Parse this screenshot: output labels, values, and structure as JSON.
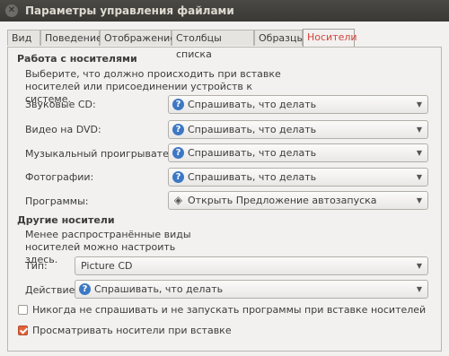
{
  "window": {
    "title": "Параметры управления файлами",
    "close_glyph": "✕"
  },
  "tabs": [
    {
      "label": "Вид"
    },
    {
      "label": "Поведение"
    },
    {
      "label": "Отображение"
    },
    {
      "label": "Столбцы списка"
    },
    {
      "label": "Образцы"
    },
    {
      "label": "Носители",
      "active": true
    }
  ],
  "media": {
    "heading": "Работа с носителями",
    "description": "Выберите, что должно происходить при вставке носителей или присоединении устройств к системе.",
    "rows": [
      {
        "label": "Звуковые CD:",
        "value": "Спрашивать, что делать",
        "icon": "question-icon"
      },
      {
        "label": "Видео на DVD:",
        "value": "Спрашивать, что делать",
        "icon": "question-icon"
      },
      {
        "label": "Музыкальный проигрыватель:",
        "value": "Спрашивать, что делать",
        "icon": "question-icon"
      },
      {
        "label": "Фотографии:",
        "value": "Спрашивать, что делать",
        "icon": "question-icon"
      },
      {
        "label": "Программы:",
        "value": "Открыть Предложение автозапуска",
        "icon": "autorun-icon"
      }
    ]
  },
  "other": {
    "heading": "Другие носители",
    "description": "Менее распространённые виды носителей можно настроить здесь.",
    "type_label": "Тип:",
    "type_value": "Picture CD",
    "action_label": "Действие:",
    "action_value": "Спрашивать, что делать"
  },
  "checkboxes": {
    "never_ask": {
      "label": "Никогда не спрашивать и не запускать программы при вставке носителей",
      "checked": false
    },
    "browse": {
      "label": "Просматривать носители при вставке",
      "checked": true
    }
  },
  "colors": {
    "accent": "#e0623a",
    "active_tab_text": "#d7433a",
    "question_icon": "#3d78c4"
  }
}
